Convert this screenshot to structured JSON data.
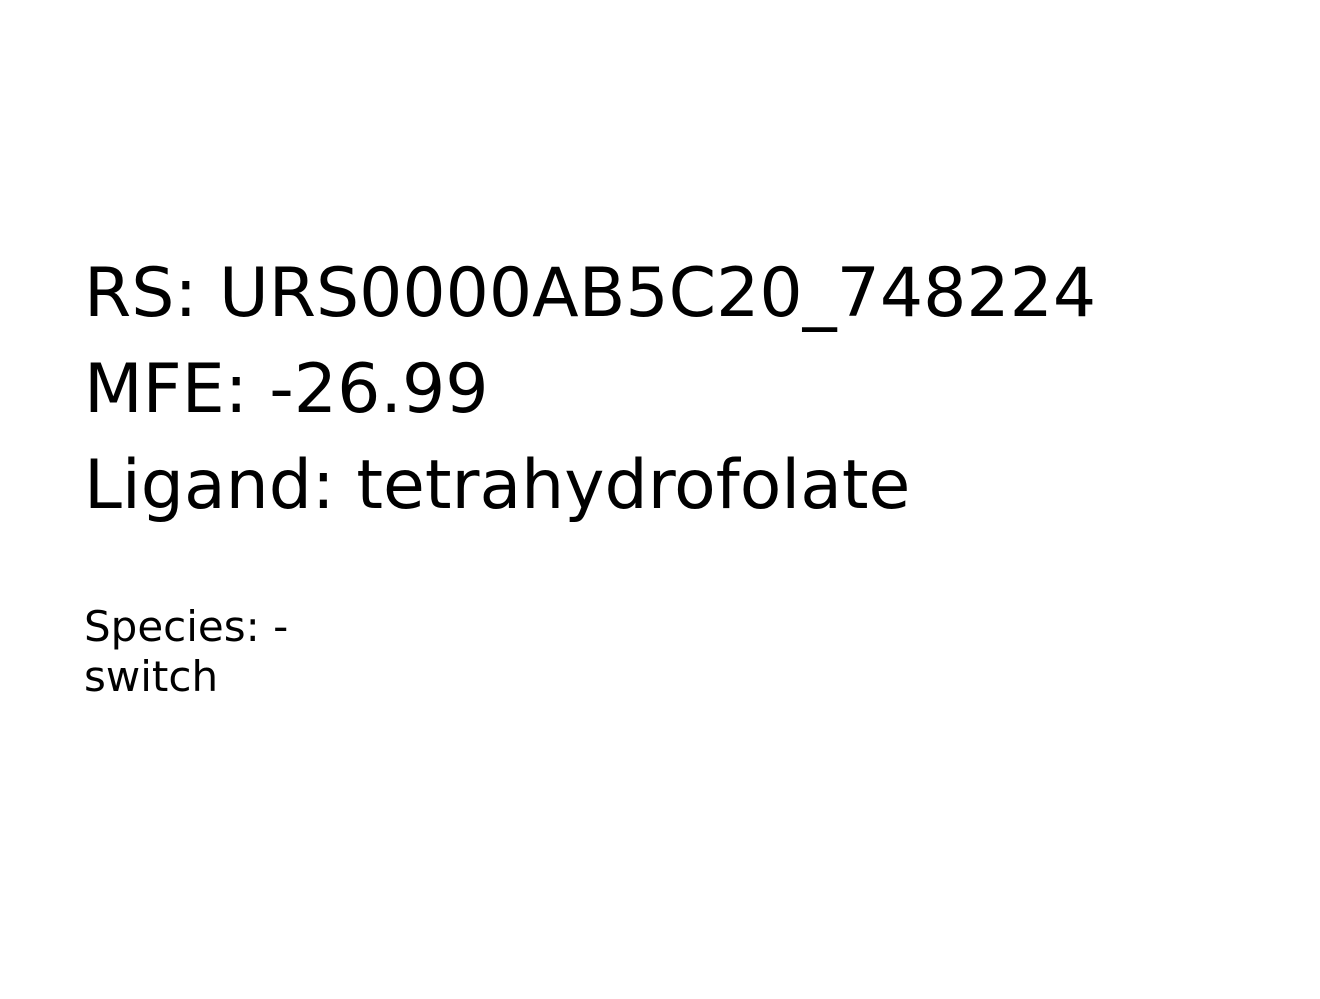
{
  "info": {
    "rs_line": "RS: URS0000AB5C20_748224",
    "mfe_line": "MFE: -26.99",
    "ligand_line": "Ligand: tetrahydrofolate"
  },
  "species": {
    "line1": "Species: -",
    "line2": "switch"
  }
}
